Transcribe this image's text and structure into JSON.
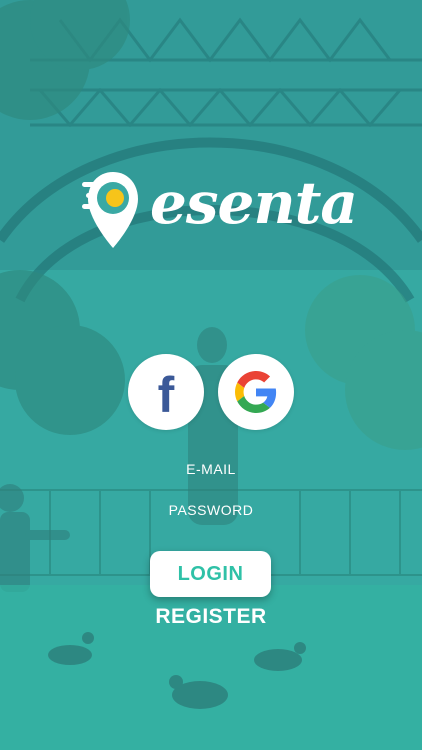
{
  "brand": {
    "name": "esenta",
    "accent_color": "#2fc1a7",
    "logo_icon": "map-pin-icon"
  },
  "social": {
    "facebook_icon": "facebook-icon",
    "facebook_glyph": "f",
    "google_icon": "google-icon"
  },
  "form": {
    "email_label": "E-MAIL",
    "password_label": "PASSWORD"
  },
  "actions": {
    "login_label": "LOGIN",
    "register_label": "REGISTER"
  }
}
